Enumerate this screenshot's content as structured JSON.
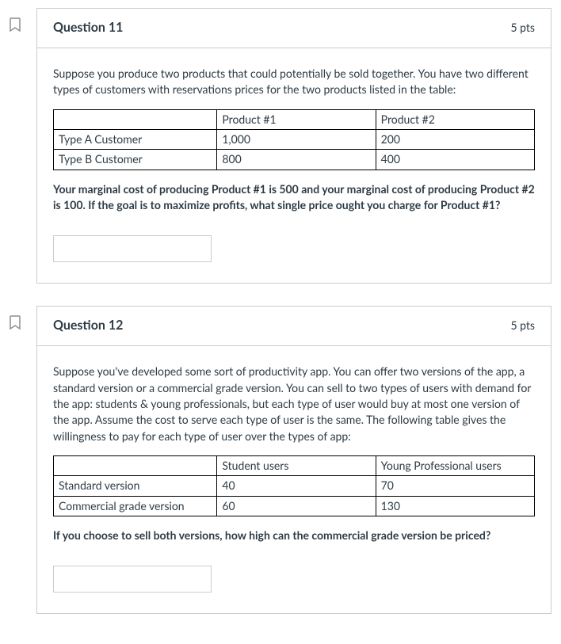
{
  "questions": [
    {
      "title": "Question 11",
      "pts": "5 pts",
      "intro": "Suppose you produce two products that could potentially be sold together. You have two different types of customers with reservations prices for the two products listed in the table:",
      "table": {
        "h0": "",
        "h1": "Product #1",
        "h2": "Product #2",
        "r1c0": "Type A Customer",
        "r1c1": "1,000",
        "r1c2": "200",
        "r2c0": "Type B Customer",
        "r2c1": "800",
        "r2c2": "400"
      },
      "followup": "Your marginal cost of producing Product #1 is 500 and your marginal cost of producing Product #2 is 100. If the goal is to maximize profits, what single price ought you charge for Product #1?"
    },
    {
      "title": "Question 12",
      "pts": "5 pts",
      "intro": "Suppose you've developed some sort of productivity app. You can offer two versions of the app, a standard version or a commercial grade version. You can sell to two types of users with demand for the app: students & young professionals, but each type of user would buy at most one version of the app. Assume the cost to serve each type of user is the same. The following table gives the willingness to pay for each type of user over the types of app:",
      "table": {
        "h0": "",
        "h1": "Student users",
        "h2": "Young Professional users",
        "r1c0": "Standard version",
        "r1c1": "40",
        "r1c2": "70",
        "r2c0": "Commercial grade version",
        "r2c1": "60",
        "r2c2": "130"
      },
      "followup": "If you choose to sell both versions, how high can the commercial grade version be priced?"
    }
  ]
}
